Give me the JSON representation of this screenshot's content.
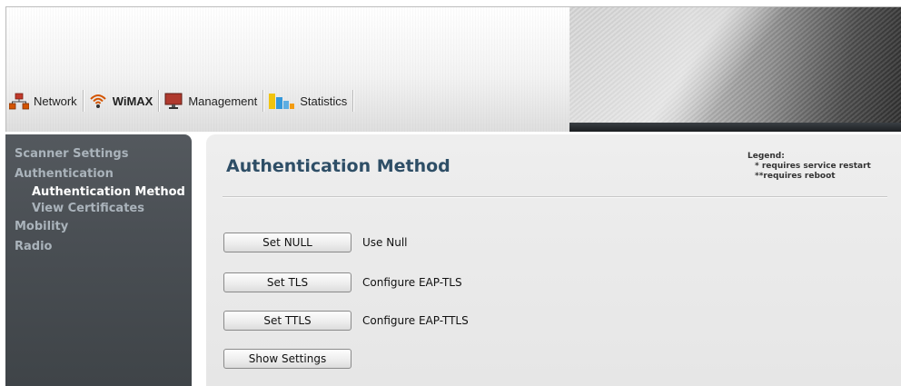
{
  "nav": {
    "tabs": [
      {
        "label": "Network",
        "icon": "network-icon",
        "active": false
      },
      {
        "label": "WiMAX",
        "icon": "wimax-signal-icon",
        "active": true
      },
      {
        "label": "Management",
        "icon": "monitor-icon",
        "active": false
      },
      {
        "label": "Statistics",
        "icon": "bar-chart-icon",
        "active": false
      }
    ]
  },
  "sidebar": {
    "items": [
      {
        "label": "Scanner Settings",
        "level": 1,
        "active": false
      },
      {
        "label": "Authentication",
        "level": 1,
        "active": false
      },
      {
        "label": "Authentication Method",
        "level": 2,
        "active": true
      },
      {
        "label": "View Certificates",
        "level": 2,
        "active": false
      },
      {
        "label": "Mobility",
        "level": 1,
        "active": false
      },
      {
        "label": "Radio",
        "level": 1,
        "active": false
      }
    ]
  },
  "main": {
    "title": "Authentication Method",
    "legend": {
      "heading": "Legend:",
      "restart_mark": "*",
      "restart_text": "requires service restart",
      "reboot_mark": "**",
      "reboot_text": "requires reboot"
    },
    "actions": [
      {
        "button": "Set NULL",
        "description": "Use Null"
      },
      {
        "button": "Set TLS",
        "description": "Configure EAP-TLS"
      },
      {
        "button": "Set TTLS",
        "description": "Configure EAP-TTLS"
      },
      {
        "button": "Show Settings",
        "description": ""
      }
    ]
  },
  "colors": {
    "title": "#2e4e66",
    "sidebar_bg": "#4a4f54",
    "sidebar_text": "#aab3bb",
    "sidebar_active": "#ffffff",
    "content_bg": "#e9e9e9"
  }
}
